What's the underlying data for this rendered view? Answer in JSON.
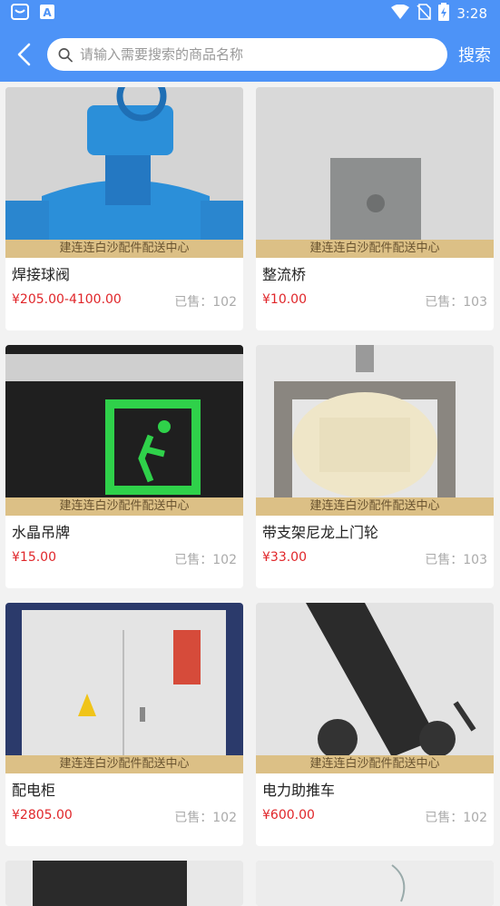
{
  "status": {
    "time": "3:28"
  },
  "header": {
    "search_placeholder": "请输入需要搜索的商品名称",
    "search_label": "搜索"
  },
  "products": [
    {
      "name": "焊接球阀",
      "price": "¥205.00-4100.00",
      "sold": "已售：102",
      "shop": "建连连白沙配件配送中心"
    },
    {
      "name": "整流桥",
      "price": "¥10.00",
      "sold": "已售：103",
      "shop": "建连连白沙配件配送中心"
    },
    {
      "name": "水晶吊牌",
      "price": "¥15.00",
      "sold": "已售：102",
      "shop": "建连连白沙配件配送中心"
    },
    {
      "name": "带支架尼龙上门轮",
      "price": "¥33.00",
      "sold": "已售：103",
      "shop": "建连连白沙配件配送中心"
    },
    {
      "name": "配电柜",
      "price": "¥2805.00",
      "sold": "已售：102",
      "shop": "建连连白沙配件配送中心"
    },
    {
      "name": "电力助推车",
      "price": "¥600.00",
      "sold": "已售：102",
      "shop": "建连连白沙配件配送中心"
    }
  ],
  "colors": {
    "accent": "#4d93f7",
    "price": "#e0262a",
    "shop_band": "#dcc086"
  }
}
